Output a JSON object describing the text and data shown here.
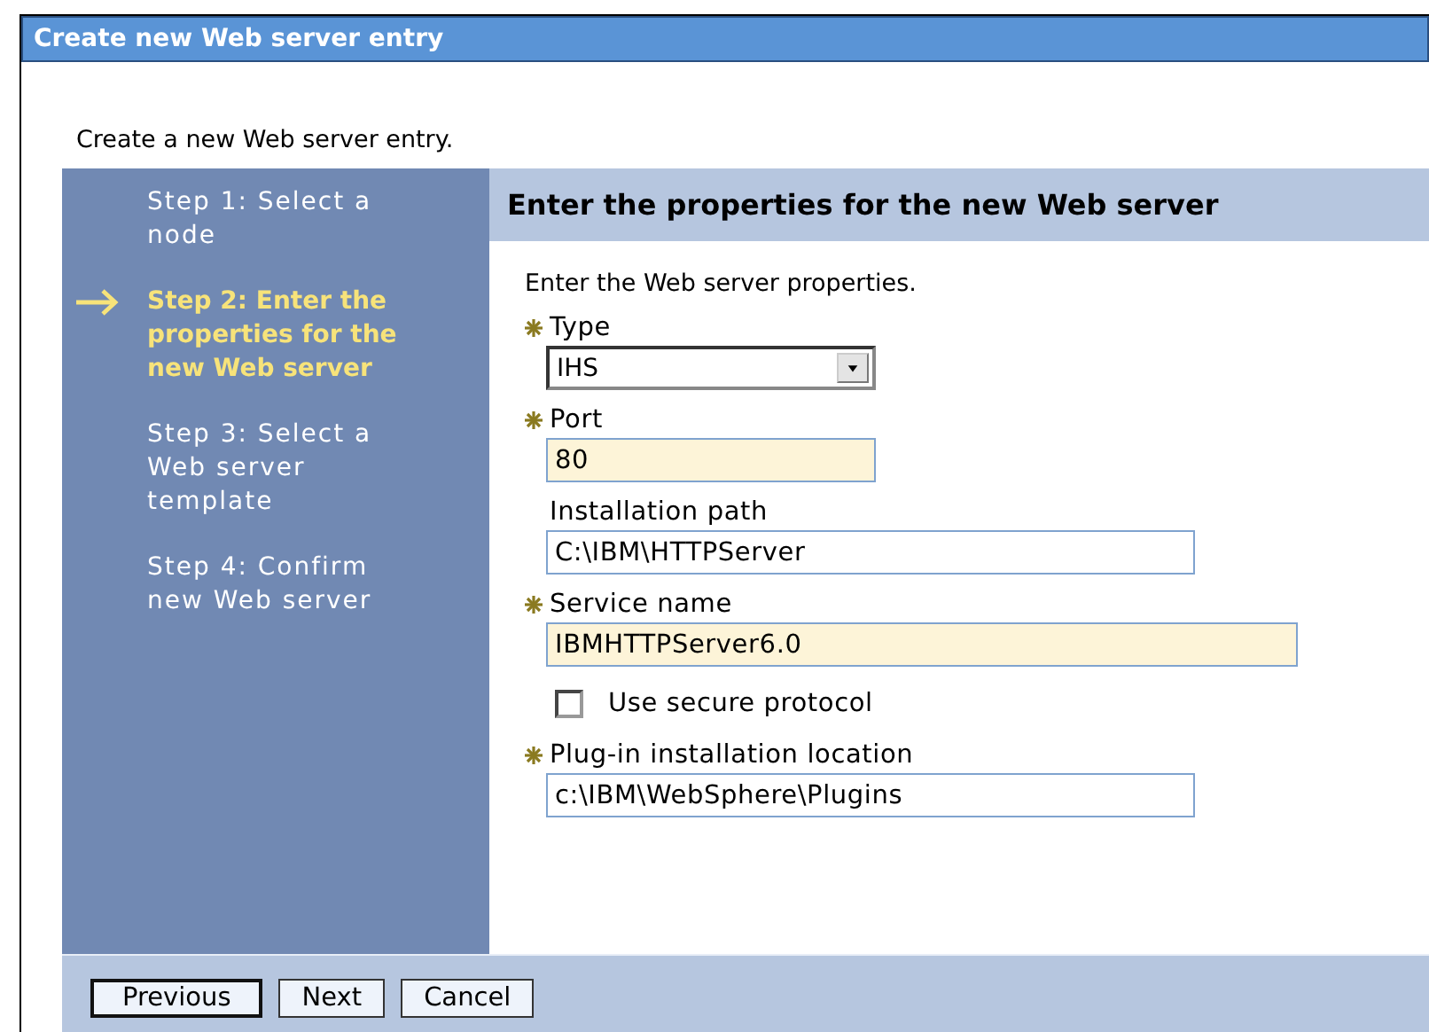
{
  "window": {
    "title": "Create new Web server entry"
  },
  "description": "Create a new Web server entry.",
  "steps": [
    {
      "label": "Step 1: Select a node",
      "selected": false
    },
    {
      "label": "Step 2: Enter the properties for the new Web server",
      "selected": true
    },
    {
      "label": "Step 3: Select a Web server template",
      "selected": false
    },
    {
      "label": "Step 4: Confirm new Web server",
      "selected": false
    }
  ],
  "panel": {
    "title": "Enter the properties for the new Web server",
    "intro": "Enter the Web server properties.",
    "fields": [
      {
        "kind": "select",
        "label": "Type",
        "required": true,
        "value": "IHS"
      },
      {
        "kind": "text",
        "label": "Port",
        "required": true,
        "value": "80",
        "highlighted": true
      },
      {
        "kind": "text",
        "label": "Installation path",
        "required": false,
        "value": "C:\\IBM\\HTTPServer",
        "highlighted": false
      },
      {
        "kind": "text",
        "label": "Service name",
        "required": true,
        "value": "IBMHTTPServer6.0",
        "highlighted": true
      },
      {
        "kind": "checkbox",
        "label": "Use secure protocol",
        "checked": false
      },
      {
        "kind": "text",
        "label": "Plug-in installation location",
        "required": true,
        "value": "c:\\IBM\\WebSphere\\Plugins",
        "highlighted": false
      }
    ]
  },
  "buttons": [
    {
      "label": "Previous",
      "default": true
    },
    {
      "label": "Next",
      "default": false
    },
    {
      "label": "Cancel",
      "default": false
    }
  ]
}
